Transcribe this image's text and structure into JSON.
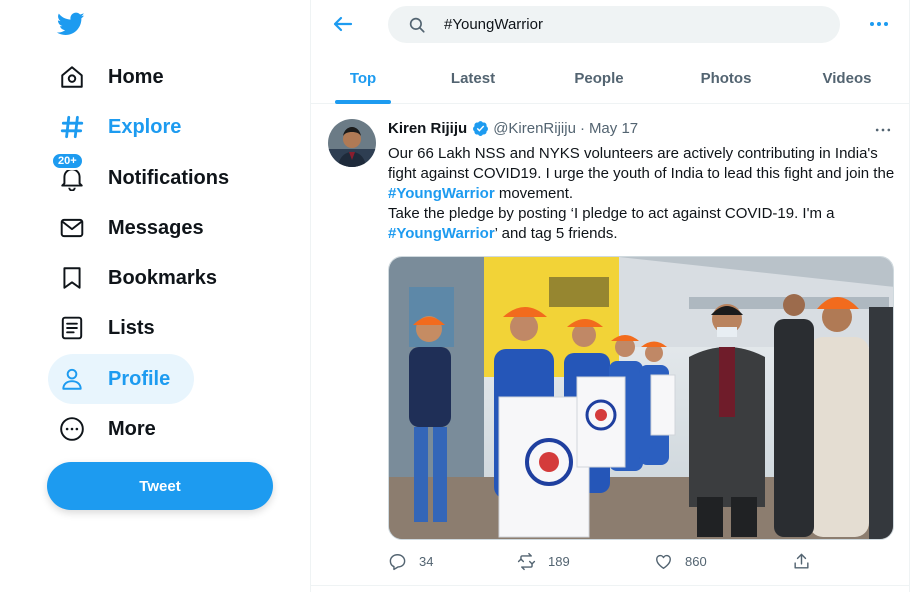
{
  "sidebar": {
    "logo_icon": "twitter-bird-icon",
    "items": [
      {
        "label": "Home",
        "icon": "home-icon"
      },
      {
        "label": "Explore",
        "icon": "hashtag-icon"
      },
      {
        "label": "Notifications",
        "icon": "bell-icon",
        "badge": "20+"
      },
      {
        "label": "Messages",
        "icon": "envelope-icon"
      },
      {
        "label": "Bookmarks",
        "icon": "bookmark-icon"
      },
      {
        "label": "Lists",
        "icon": "list-icon"
      },
      {
        "label": "Profile",
        "icon": "person-icon"
      },
      {
        "label": "More",
        "icon": "more-circle-icon"
      }
    ],
    "tweet_button": "Tweet"
  },
  "search": {
    "value": "#YoungWarrior"
  },
  "tabs": [
    "Top",
    "Latest",
    "People",
    "Photos",
    "Videos"
  ],
  "active_tab": "Top",
  "tweet": {
    "name": "Kiren Rijiju",
    "handle": "@KirenRijiju",
    "dot": "·",
    "date": "May 17",
    "text_1": "Our 66 Lakh NSS and NYKS volunteers are actively contributing in India's fight against COVID19. I urge the youth of India to lead this fight and join the ",
    "hashtag_1": "#YoungWarrior",
    "text_2": " movement.",
    "text_3": "Take the pledge by posting ‘I pledge to act against COVID-19. I'm a ",
    "hashtag_2": "#YoungWarrior",
    "text_4": "’ and tag 5 friends.",
    "replies": "34",
    "retweets": "189",
    "likes": "860"
  },
  "colors": {
    "accent": "#1d9bf0",
    "text": "#0f1419",
    "muted": "#536471",
    "active_bg": "#e8f5fd"
  }
}
